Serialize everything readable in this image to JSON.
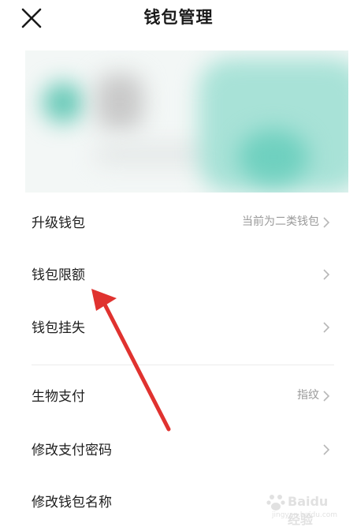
{
  "header": {
    "title": "钱包管理"
  },
  "menu": [
    {
      "label": "升级钱包",
      "value": "当前为二类钱包"
    },
    {
      "label": "钱包限额",
      "value": ""
    },
    {
      "label": "钱包挂失",
      "value": ""
    },
    {
      "label": "生物支付",
      "value": "指纹"
    },
    {
      "label": "修改支付密码",
      "value": ""
    },
    {
      "label": "修改钱包名称",
      "value": ""
    }
  ],
  "watermark": {
    "brand": "Baidu 经验",
    "url": "jingyan.baidu.com"
  },
  "colors": {
    "accent_teal": "#7fd6c6",
    "arrow_red": "#e0322f",
    "chevron": "#b7b7b7"
  },
  "icons": {
    "close": "close-icon",
    "chevron": "chevron-right-icon"
  }
}
